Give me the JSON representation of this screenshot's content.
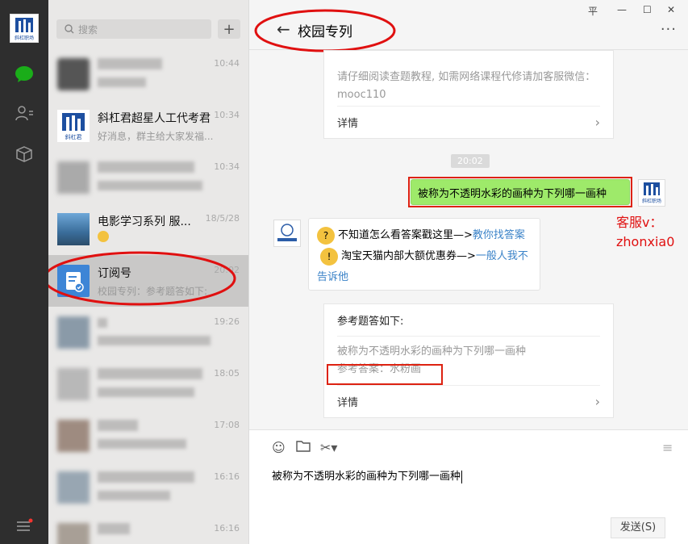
{
  "search": {
    "placeholder": "搜索"
  },
  "rail": {
    "logo_text": "斜杠职场"
  },
  "chats": [
    {
      "name": "",
      "preview": "",
      "time": "10:44"
    },
    {
      "name": "斜杠君超星人工代考君",
      "preview": "好消息，群主给大家发福...",
      "time": "10:34",
      "avatar_text": "斜杠君"
    },
    {
      "name": "",
      "preview": "",
      "time": "10:34"
    },
    {
      "name": "电影学习系列 服...",
      "preview": "",
      "time": "18/5/28"
    },
    {
      "name": "订阅号",
      "preview": "校园专列：参考题答如下:",
      "time": "20:02"
    },
    {
      "name": "",
      "preview": "",
      "time": "19:26"
    },
    {
      "name": "",
      "preview": "",
      "time": "18:05"
    },
    {
      "name": "",
      "preview": "",
      "time": "17:08"
    },
    {
      "name": "",
      "preview": "",
      "time": "16:16"
    },
    {
      "name": "",
      "preview": "",
      "time": "16:16"
    }
  ],
  "window": {
    "pin": "平",
    "minimize": "—",
    "maximize": "☐",
    "close": "✕"
  },
  "conversation": {
    "title": "校园专列",
    "more": "···",
    "card1": {
      "text": "请仔细阅读查题教程, 如需网络课程代修请加客服微信：mooc110",
      "footer": "详情"
    },
    "time_badge": "20:02",
    "outgoing": "被称为不透明水彩的画种为下列哪一画种",
    "annotation_line1": "客服v：",
    "annotation_line2": "zhonxia0",
    "incoming": {
      "part1": "不知道怎么看答案戳这里—>",
      "link1": "教你找答案",
      "part2": "淘宝天猫内部大额优惠券—>",
      "link2": "一般人我不告诉他"
    },
    "card2": {
      "title": "参考题答如下:",
      "question": "被称为不透明水彩的画种为下列哪一画种",
      "answer": "参考答案：水粉画",
      "footer": "详情"
    }
  },
  "input": {
    "text": "被称为不透明水彩的画种为下列哪一画种",
    "send_label": "发送(S)"
  },
  "colors": {
    "accent_green": "#9eea6a",
    "annotation_red": "#e01010",
    "link_blue": "#3b83c8"
  }
}
